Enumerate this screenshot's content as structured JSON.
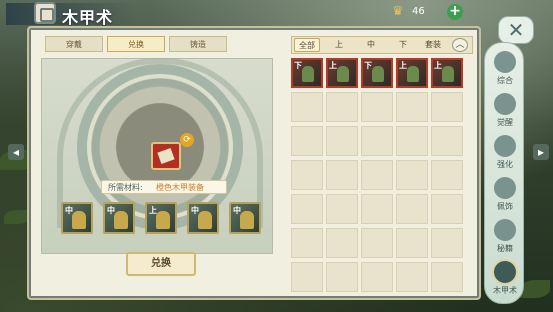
{
  "header": {
    "title": "木甲术",
    "currency_icon": "coin-crown-icon",
    "currency_value": "46",
    "add_label": "+"
  },
  "left_tabs": [
    "穿戴",
    "兑换",
    "铸造"
  ],
  "active_left_tab": 1,
  "exchange": {
    "material_label": "所需材料:",
    "material_value": "橙色木甲装备",
    "swap_icon": "⟳",
    "button_label": "兑换",
    "slots": [
      "中",
      "中",
      "上",
      "中",
      "中"
    ]
  },
  "filters": [
    "全部",
    "上",
    "中",
    "下",
    "套装"
  ],
  "active_filter": 0,
  "collapse_symbol": "︿",
  "inventory": {
    "items": [
      "下",
      "上",
      "下",
      "上",
      "上"
    ],
    "total_cells": 35
  },
  "side_menu": [
    {
      "label": "综合",
      "icon": "swirl-icon"
    },
    {
      "label": "觉醒",
      "icon": "awaken-icon"
    },
    {
      "label": "强化",
      "icon": "anvil-icon"
    },
    {
      "label": "佩饰",
      "icon": "ornament-icon"
    },
    {
      "label": "秘籍",
      "icon": "book-icon"
    },
    {
      "label": "木甲术",
      "icon": "gear-icon"
    }
  ],
  "close_symbol": "✕",
  "arrows": {
    "left": "◂",
    "right": "▸"
  },
  "colors": {
    "accent": "#c9a95a",
    "item_border": "#b33b2b",
    "material": "#d27a2a"
  }
}
